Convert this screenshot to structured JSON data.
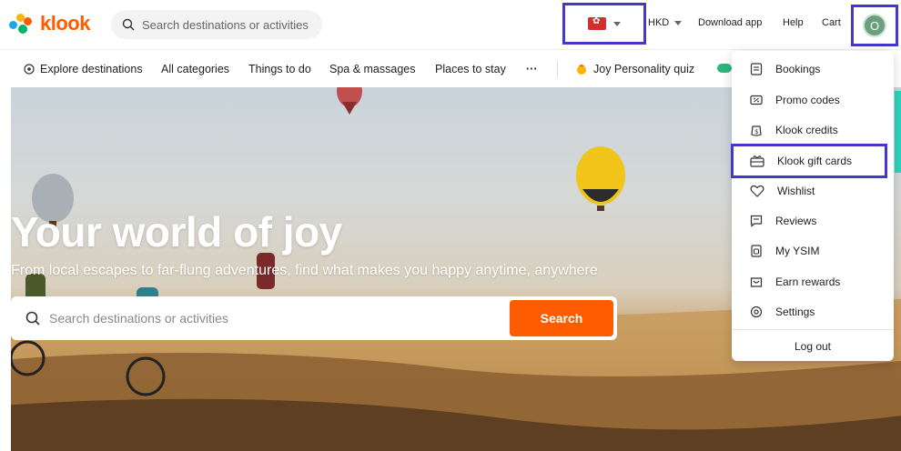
{
  "header": {
    "logo_text": "klook",
    "search_placeholder": "Search destinations or activities",
    "currency": "HKD",
    "links": [
      "Download app",
      "Help",
      "Cart"
    ],
    "avatar_initial": "O",
    "brand_color": "#ff5b00",
    "highlight_color": "#4338ca"
  },
  "categories": [
    "Explore destinations",
    "All categories",
    "Things to do",
    "Spa & massages",
    "Places to stay",
    "···",
    "Joy Personality quiz"
  ],
  "hero": {
    "title": "Your world of joy",
    "subtitle": "From local escapes to far-flung adventures, find what makes you happy anytime, anywhere",
    "search_placeholder": "Search destinations or activities",
    "search_button": "Search"
  },
  "menu": {
    "items": [
      {
        "label": "Bookings",
        "icon": "bookings-icon"
      },
      {
        "label": "Promo codes",
        "icon": "promo-codes-icon"
      },
      {
        "label": "Klook credits",
        "icon": "credits-icon"
      },
      {
        "label": "Klook gift cards",
        "icon": "gift-card-icon"
      },
      {
        "label": "Wishlist",
        "icon": "heart-icon"
      },
      {
        "label": "Reviews",
        "icon": "reviews-icon"
      },
      {
        "label": "My YSIM",
        "icon": "sim-icon"
      },
      {
        "label": "Earn rewards",
        "icon": "rewards-icon"
      },
      {
        "label": "Settings",
        "icon": "settings-icon"
      }
    ],
    "logout": "Log out"
  }
}
